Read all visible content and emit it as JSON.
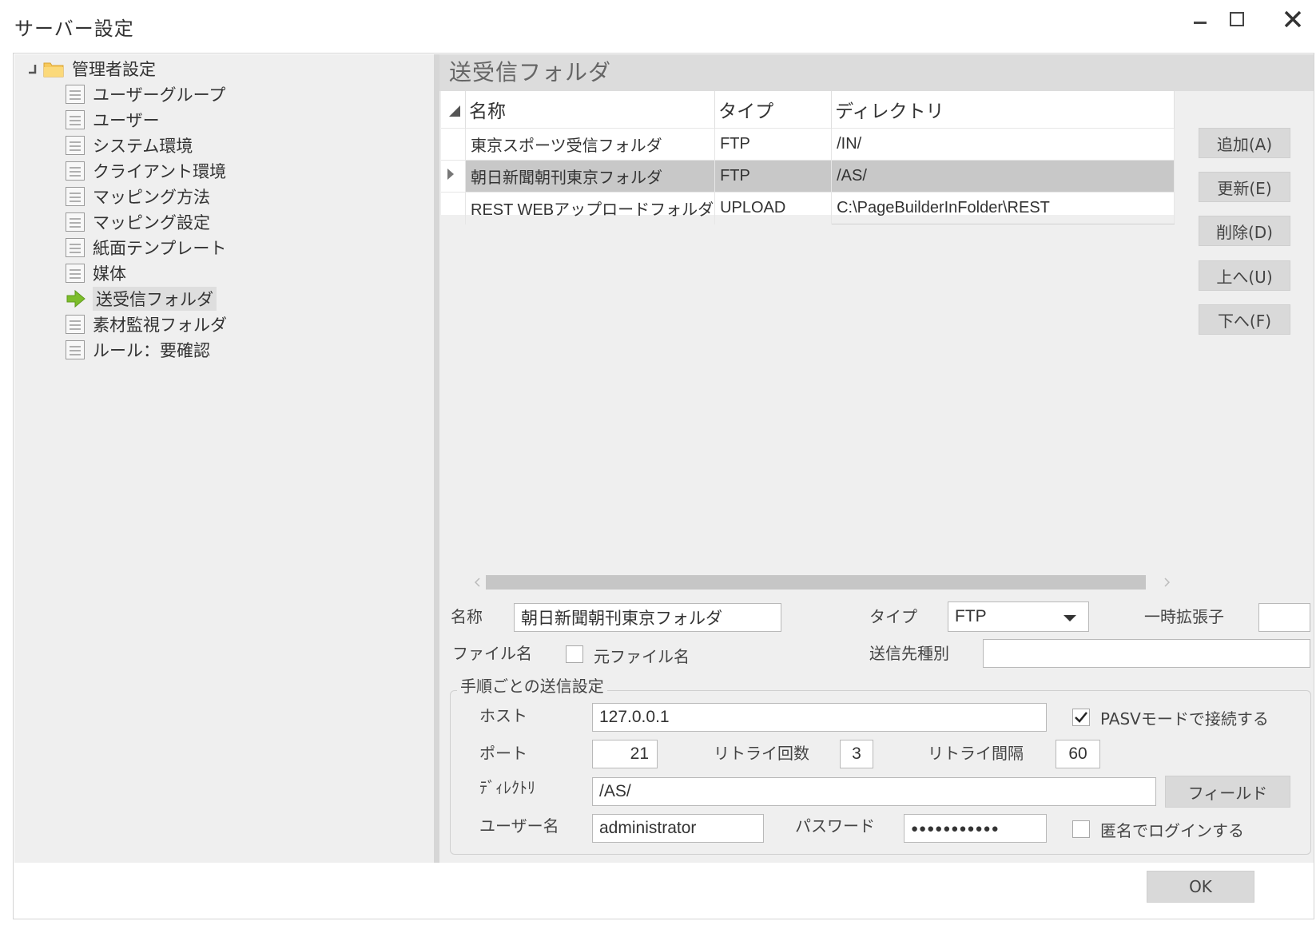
{
  "window": {
    "title": "サーバー設定"
  },
  "tree": {
    "root_label": "管理者設定",
    "items": [
      {
        "label": "ユーザーグループ"
      },
      {
        "label": "ユーザー"
      },
      {
        "label": "システム環境"
      },
      {
        "label": "クライアント環境"
      },
      {
        "label": "マッピング方法"
      },
      {
        "label": "マッピング設定"
      },
      {
        "label": "紙面テンプレート"
      },
      {
        "label": "媒体"
      },
      {
        "label": "送受信フォルダ",
        "selected": true
      },
      {
        "label": "素材監視フォルダ"
      },
      {
        "label": "ルール：要確認"
      }
    ]
  },
  "section": {
    "title": "送受信フォルダ"
  },
  "grid": {
    "columns": [
      "名称",
      "タイプ",
      "ディレクトリ"
    ],
    "rows": [
      {
        "name": "東京スポーツ受信フォルダ",
        "type": "FTP",
        "directory": "/IN/"
      },
      {
        "name": "朝日新聞朝刊東京フォルダ",
        "type": "FTP",
        "directory": "/AS/",
        "selected": true
      },
      {
        "name": "REST WEBアップロードフォルダ",
        "type": "UPLOAD",
        "directory": "C:\\PageBuilderInFolder\\REST"
      }
    ]
  },
  "side_buttons": {
    "add": "追加(A)",
    "update": "更新(E)",
    "delete": "削除(D)",
    "up": "上へ(U)",
    "down": "下へ(F)"
  },
  "form": {
    "name_label": "名称",
    "name_value": "朝日新聞朝刊東京フォルダ",
    "type_label": "タイプ",
    "type_value": "FTP",
    "temp_ext_label": "一時拡張子",
    "temp_ext_value": "",
    "filename_label": "ファイル名",
    "original_filename_label": "元ファイル名",
    "original_filename_checked": false,
    "dest_type_label": "送信先種別",
    "dest_type_value": "",
    "group_label": "手順ごとの送信設定",
    "host_label": "ホスト",
    "host_value": "127.0.0.1",
    "pasv_label": "PASVモードで接続する",
    "pasv_checked": true,
    "port_label": "ポート",
    "port_value": "21",
    "retry_count_label": "リトライ回数",
    "retry_count_value": "3",
    "retry_interval_label": "リトライ間隔",
    "retry_interval_value": "60",
    "directory_label": "ﾃﾞｨﾚｸﾄﾘ",
    "directory_value": "/AS/",
    "field_button": "フィールド",
    "username_label": "ユーザー名",
    "username_value": "administrator",
    "password_label": "パスワード",
    "password_value": "●●●●●●●●●●●",
    "anonymous_label": "匿名でログインする",
    "anonymous_checked": false
  },
  "footer": {
    "ok_label": "OK"
  },
  "colors": {
    "pane_bg": "#efefef",
    "header_bg": "#dcdcdc",
    "selected_row": "#c8c8c8",
    "button_bg": "#d9d9d9",
    "arrow_green": "#7cbd2a"
  }
}
